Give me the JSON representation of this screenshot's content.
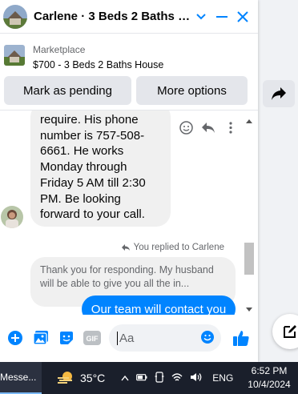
{
  "window": {
    "title": "Carlene · 3 Beds 2 Baths H...",
    "listing_source": "Marketplace",
    "listing_name": "$700 - 3 Beds 2 Baths House"
  },
  "actions": {
    "mark_pending": "Mark as pending",
    "more_options": "More options"
  },
  "thread": {
    "incoming_lines": [
      "require. His phone",
      "number is 757-508-",
      "6661. He works",
      "Monday through",
      "Friday 5 AM till 2:30",
      "PM. Be looking",
      "forward to your call."
    ],
    "replied_label": "You replied to Carlene",
    "quoted_text": "Thank you for responding. My husband will be able to give you all the in...",
    "outgoing_text": "Our team will contact you"
  },
  "composer": {
    "placeholder": "Aa",
    "gif_label": "GIF"
  },
  "taskbar": {
    "app_label": "Messe...",
    "temperature": "35°C",
    "language": "ENG",
    "time": "6:52 PM",
    "date": "10/4/2024"
  },
  "colors": {
    "accent": "#0084ff",
    "bubble_in": "#f0f0f0",
    "secondary_text": "#65676b",
    "taskbar_bg": "#1a1f2b"
  }
}
